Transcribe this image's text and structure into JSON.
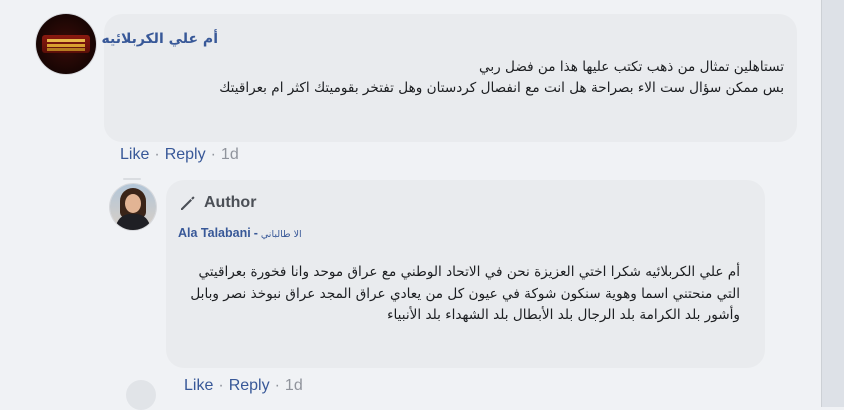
{
  "comment1": {
    "author": "أم علي الكربلائيه",
    "lines": [
      "تستاهلين تمثال من ذهب تكتب عليها هذا من فضل ربي",
      "بس ممكن سؤال ست الاء بصراحة هل انت مع انفصال كردستان وهل تفتخر بقوميتك اكثر ام بعراقيتك"
    ],
    "actions": {
      "like": "Like",
      "reply": "Reply",
      "time": "1d"
    }
  },
  "reply1": {
    "badge": "Author",
    "author": "Ala Talabani",
    "author_native": "الا طالباني",
    "lines": [
      "أم علي الكربلائيه  شكرا اختي العزيزة نحن في الاتحاد الوطني مع عراق موحد وانا فخورة بعراقيتي التي منحتني اسما وهوية سنكون شوكة في عيون كل من يعادي عراق المجد عراق نبوخذ نصر وبابل وأشور بلد الكرامة بلد الرجال بلد الأبطال بلد الشهداء بلد الأنبياء"
    ],
    "actions": {
      "like": "Like",
      "reply": "Reply",
      "time": "1d"
    }
  },
  "icons": {
    "badge_icon": "pencil-icon"
  },
  "colors": {
    "background": "#f0f2f5",
    "bubble": "#e9ebee",
    "name_link": "#385898",
    "text": "#1c1e21",
    "meta": "#90949c"
  }
}
